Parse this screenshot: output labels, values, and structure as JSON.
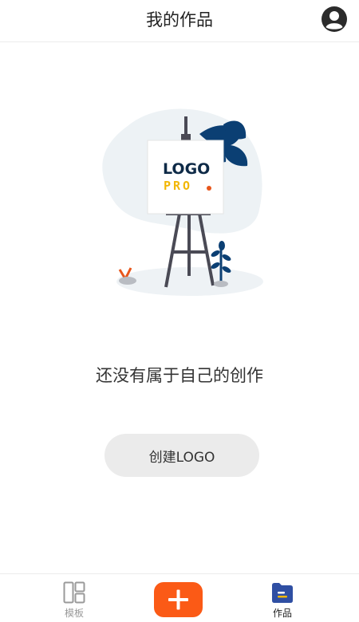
{
  "header": {
    "title": "我的作品",
    "profile_icon": "user-circle-icon"
  },
  "illustration": {
    "logo_text": "LOGO",
    "logo_sub": "PRO",
    "accent_color": "#f2b707",
    "dot_color": "#e8561b",
    "leaf_color": "#0b3f73"
  },
  "empty_state": {
    "message": "还没有属于自己的创作",
    "button_label": "创建LOGO"
  },
  "tabbar": {
    "templates_label": "模板",
    "templates_icon": "layout-grid-icon",
    "add_icon": "plus-icon",
    "add_color": "#fb5a16",
    "works_label": "作品",
    "works_icon": "folder-icon",
    "works_icon_color": "#2f4fa3"
  }
}
